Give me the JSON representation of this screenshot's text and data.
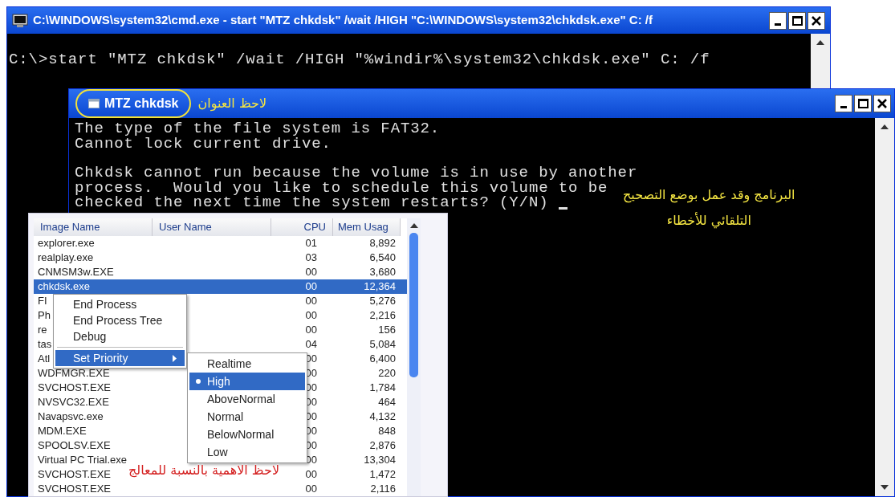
{
  "cmd_window": {
    "title": "C:\\WINDOWS\\system32\\cmd.exe - start \"MTZ chkdsk\" /wait /HIGH \"C:\\WINDOWS\\system32\\chkdsk.exe\" C: /f",
    "command": "C:\\>start \"MTZ chkdsk\" /wait /HIGH \"%windir%\\system32\\chkdsk.exe\" C: /f"
  },
  "chkdsk_window": {
    "title": "MTZ chkdsk",
    "title_note": "لاحظ العنوان",
    "paragraphs": [
      [
        "The type of the file system is FAT32.",
        "Cannot lock current drive."
      ],
      [
        "Chkdsk cannot run because the volume is in use by another",
        "process.  Would you like to schedule this volume to be",
        "checked the next time the system restarts? (Y/N)"
      ]
    ],
    "note_lines": [
      "البرنامج وقد عمل بوضع التصحيح",
      "التلقائي للأخطاء"
    ]
  },
  "task_manager": {
    "columns": [
      "Image Name",
      "User Name",
      "CPU",
      "Mem Usag"
    ],
    "rows": [
      {
        "name": "explorer.exe",
        "cpu": "01",
        "mem": "8,892",
        "selected": false
      },
      {
        "name": "realplay.exe",
        "cpu": "03",
        "mem": "6,540",
        "selected": false
      },
      {
        "name": "CNMSM3w.EXE",
        "cpu": "00",
        "mem": "3,680",
        "selected": false
      },
      {
        "name": "chkdsk.exe",
        "cpu": "00",
        "mem": "12,364",
        "selected": true
      },
      {
        "name": "FI",
        "cpu": "00",
        "mem": "5,276",
        "selected": false
      },
      {
        "name": "Ph",
        "cpu": "00",
        "mem": "2,216",
        "selected": false
      },
      {
        "name": "re",
        "cpu": "00",
        "mem": "156",
        "selected": false
      },
      {
        "name": "tas",
        "cpu": "04",
        "mem": "5,084",
        "selected": false
      },
      {
        "name": "Atl",
        "cpu": "00",
        "mem": "6,400",
        "selected": false
      },
      {
        "name": "WDFMGR.EXE",
        "cpu": "00",
        "mem": "220",
        "selected": false
      },
      {
        "name": "SVCHOST.EXE",
        "cpu": "00",
        "mem": "1,784",
        "selected": false
      },
      {
        "name": "NVSVC32.EXE",
        "cpu": "00",
        "mem": "464",
        "selected": false
      },
      {
        "name": "Navapsvc.exe",
        "cpu": "00",
        "mem": "4,132",
        "selected": false
      },
      {
        "name": "MDM.EXE",
        "cpu": "00",
        "mem": "848",
        "selected": false
      },
      {
        "name": "SPOOLSV.EXE",
        "cpu": "00",
        "mem": "2,876",
        "selected": false
      },
      {
        "name": "Virtual PC Trial.exe",
        "cpu": "00",
        "mem": "13,304",
        "selected": false
      },
      {
        "name": "SVCHOST.EXE",
        "cpu": "00",
        "mem": "1,472",
        "selected": false
      },
      {
        "name": "SVCHOST.EXE",
        "cpu": "00",
        "mem": "2,116",
        "selected": false
      }
    ]
  },
  "context_menu": {
    "items": [
      {
        "kind": "item",
        "label": "End Process",
        "selected": false
      },
      {
        "kind": "item",
        "label": "End Process Tree",
        "selected": false
      },
      {
        "kind": "item",
        "label": "Debug",
        "selected": false
      },
      {
        "kind": "separator"
      },
      {
        "kind": "submenu",
        "label": "Set Priority",
        "selected": true
      }
    ]
  },
  "priority_menu": {
    "items": [
      {
        "label": "Realtime",
        "selected": false
      },
      {
        "label": "High",
        "selected": true
      },
      {
        "label": "AboveNormal",
        "selected": false
      },
      {
        "label": "Normal",
        "selected": false
      },
      {
        "label": "BelowNormal",
        "selected": false
      },
      {
        "label": "Low",
        "selected": false
      }
    ]
  },
  "bottom_note": "لاحظ الاهمية بالنسبة للمعالج"
}
